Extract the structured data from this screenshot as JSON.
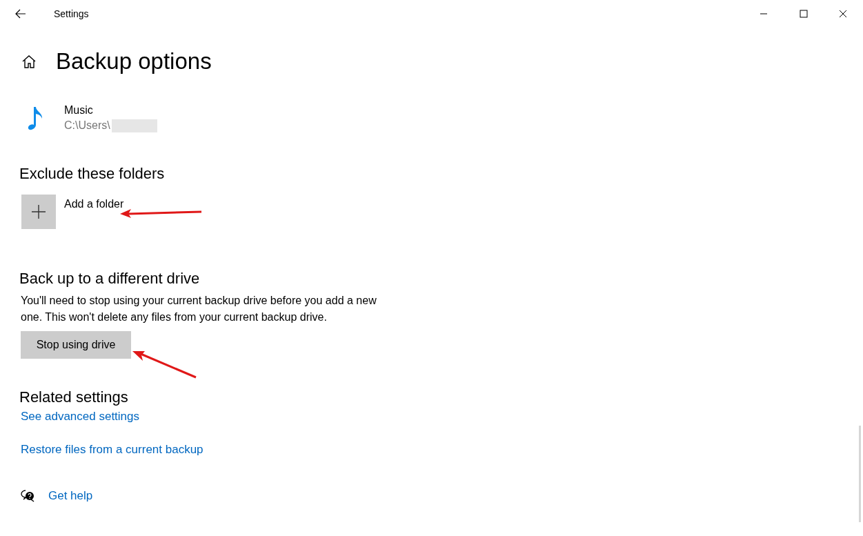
{
  "window": {
    "title": "Settings"
  },
  "page": {
    "heading": "Backup options"
  },
  "backup_folders": [
    {
      "name": "Music",
      "path": "C:\\Users\\"
    }
  ],
  "exclude": {
    "heading": "Exclude these folders",
    "add_label": "Add a folder"
  },
  "different_drive": {
    "heading": "Back up to a different drive",
    "description": "You'll need to stop using your current backup drive before you add a new one. This won't delete any files from your current backup drive.",
    "button": "Stop using drive"
  },
  "related_settings": {
    "heading": "Related settings",
    "links": [
      "See advanced settings",
      "Restore files from a current backup"
    ]
  },
  "help": {
    "label": "Get help"
  }
}
